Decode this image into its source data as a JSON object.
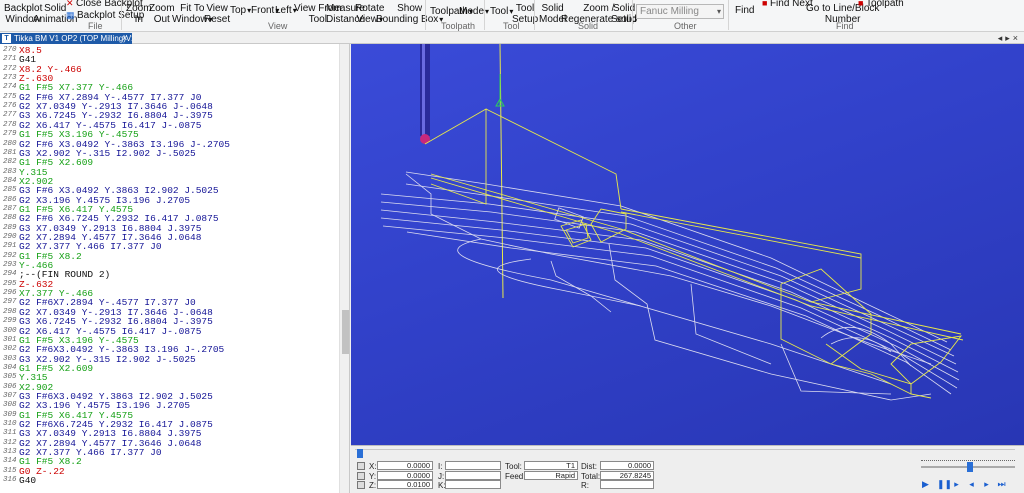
{
  "ribbon": {
    "buttons": [
      {
        "key": "backplot_window",
        "l1": "Backplot",
        "l2": "Window",
        "dd": false
      },
      {
        "key": "solid_animation",
        "l1": "Solid",
        "l2": "Animation",
        "dd": false
      },
      {
        "key": "close_backplot",
        "l1": "Close Backplot",
        "l2": "",
        "dd": false
      },
      {
        "key": "backplot_setup",
        "l1": "Backplot Setup",
        "l2": "",
        "dd": false
      },
      {
        "key": "zoom_in",
        "l1": "Zoom",
        "l2": "In",
        "dd": false
      },
      {
        "key": "zoom_out",
        "l1": "Zoom",
        "l2": "Out",
        "dd": false
      },
      {
        "key": "fit_to_window",
        "l1": "Fit To",
        "l2": "Window",
        "dd": true
      },
      {
        "key": "view_reset",
        "l1": "View",
        "l2": "Reset",
        "dd": false
      },
      {
        "key": "top",
        "l1": "",
        "l2": "Top",
        "dd": true
      },
      {
        "key": "front",
        "l1": "",
        "l2": "Front",
        "dd": true
      },
      {
        "key": "left",
        "l1": "",
        "l2": "Left",
        "dd": true
      },
      {
        "key": "view_from_tool",
        "l1": "View From",
        "l2": "Tool",
        "dd": false
      },
      {
        "key": "measure_distance",
        "l1": "Measure",
        "l2": "Distance",
        "dd": false
      },
      {
        "key": "rotate_view",
        "l1": "Rotate",
        "l2": "View",
        "dd": true
      },
      {
        "key": "show_bounding_box",
        "l1": "Show",
        "l2": "Bounding Box",
        "dd": true
      },
      {
        "key": "toolpath",
        "l1": "Toolpath",
        "l2": "",
        "dd": true
      },
      {
        "key": "mode",
        "l1": "Mode",
        "l2": "",
        "dd": true
      },
      {
        "key": "tool",
        "l1": "Tool",
        "l2": "",
        "dd": true
      },
      {
        "key": "tool_setup",
        "l1": "Tool",
        "l2": "Setup",
        "dd": false
      },
      {
        "key": "solid_model",
        "l1": "Solid",
        "l2": "Model",
        "dd": false
      },
      {
        "key": "zoom_regenerate",
        "l1": "Zoom /",
        "l2": "Regenerate solid",
        "dd": false
      },
      {
        "key": "solid_setup",
        "l1": "Solid",
        "l2": "Setup",
        "dd": false
      },
      {
        "key": "find",
        "l1": "Find",
        "l2": "",
        "dd": false
      },
      {
        "key": "find_next",
        "l1": "Find Next",
        "l2": "",
        "dd": false
      },
      {
        "key": "go_to_line",
        "l1": "Go to Line/Block",
        "l2": "Number",
        "dd": false
      },
      {
        "key": "previous_tool_change",
        "l1": "Previous Tool change",
        "l2": "",
        "dd": false
      },
      {
        "key": "toolpath_statistics",
        "l1": "Toolpath",
        "l2": "Statistics",
        "dd": false
      }
    ],
    "groups": [
      "File",
      "View",
      "Toolpath",
      "Tool",
      "Solid",
      "Other",
      "Find"
    ],
    "machine_select": "Fanuc Milling"
  },
  "tab": {
    "title": "Tikka BM V1 OP2 (TOP Milling)V2.NC",
    "close": "×",
    "controls": "◂▸×"
  },
  "colors": {
    "red": "#cc0000",
    "green": "#14a014",
    "blue": "#141496",
    "black": "#111111",
    "toolpath_white": "#dcdcf0",
    "toolpath_yellow": "#e8e84a",
    "viewport_bg": "#3545cf"
  },
  "code_lines": [
    {
      "n": "270",
      "t": "X8.5",
      "c": "red"
    },
    {
      "n": "271",
      "t": "G41",
      "c": "black"
    },
    {
      "n": "272",
      "t": "X8.2 Y-.466",
      "c": "red"
    },
    {
      "n": "273",
      "t": "Z-.630",
      "c": "red"
    },
    {
      "n": "274",
      "t": "G1 F#5 X7.377 Y-.466",
      "c": "green"
    },
    {
      "n": "275",
      "t": "G2 F#6 X7.2894 Y-.4577 I7.377 J0",
      "c": "blue"
    },
    {
      "n": "276",
      "t": "G2 X7.0349 Y-.2913 I7.3646 J-.0648",
      "c": "blue"
    },
    {
      "n": "277",
      "t": "G3 X6.7245 Y-.2932 I6.8804 J-.3975",
      "c": "blue"
    },
    {
      "n": "278",
      "t": "G2 X6.417 Y-.4575 I6.417 J-.0875",
      "c": "blue"
    },
    {
      "n": "279",
      "t": "G1 F#5 X3.196 Y-.4575",
      "c": "green"
    },
    {
      "n": "280",
      "t": "G2 F#6 X3.0492 Y-.3863 I3.196 J-.2705",
      "c": "blue"
    },
    {
      "n": "281",
      "t": "G3 X2.902 Y-.315 I2.902 J-.5025",
      "c": "blue"
    },
    {
      "n": "282",
      "t": "G1 F#5 X2.609",
      "c": "green"
    },
    {
      "n": "283",
      "t": "Y.315",
      "c": "green"
    },
    {
      "n": "284",
      "t": "X2.902",
      "c": "green"
    },
    {
      "n": "285",
      "t": "G3 F#6 X3.0492 Y.3863 I2.902 J.5025",
      "c": "blue"
    },
    {
      "n": "286",
      "t": "G2 X3.196 Y.4575 I3.196 J.2705",
      "c": "blue"
    },
    {
      "n": "287",
      "t": "G1 F#5 X6.417 Y.4575",
      "c": "green"
    },
    {
      "n": "288",
      "t": "G2 F#6 X6.7245 Y.2932 I6.417 J.0875",
      "c": "blue"
    },
    {
      "n": "289",
      "t": "G3 X7.0349 Y.2913 I6.8804 J.3975",
      "c": "blue"
    },
    {
      "n": "290",
      "t": "G2 X7.2894 Y.4577 I7.3646 J.0648",
      "c": "blue"
    },
    {
      "n": "291",
      "t": "G2 X7.377 Y.466 I7.377 J0",
      "c": "blue"
    },
    {
      "n": "292",
      "t": "G1 F#5 X8.2",
      "c": "green"
    },
    {
      "n": "293",
      "t": "Y-.466",
      "c": "green"
    },
    {
      "n": "294",
      "t": ";--(FIN ROUND 2)",
      "c": "black"
    },
    {
      "n": "295",
      "t": "Z-.632",
      "c": "red"
    },
    {
      "n": "296",
      "t": "X7.377 Y-.466",
      "c": "green"
    },
    {
      "n": "297",
      "t": "G2 F#6X7.2894 Y-.4577 I7.377 J0",
      "c": "blue"
    },
    {
      "n": "298",
      "t": "G2 X7.0349 Y-.2913 I7.3646 J-.0648",
      "c": "blue"
    },
    {
      "n": "299",
      "t": "G3 X6.7245 Y-.2932 I6.8804 J-.3975",
      "c": "blue"
    },
    {
      "n": "300",
      "t": "G2 X6.417 Y-.4575 I6.417 J-.0875",
      "c": "blue"
    },
    {
      "n": "301",
      "t": "G1 F#5 X3.196 Y-.4575",
      "c": "green"
    },
    {
      "n": "302",
      "t": "G2 F#6X3.0492 Y-.3863 I3.196 J-.2705",
      "c": "blue"
    },
    {
      "n": "303",
      "t": "G3 X2.902 Y-.315 I2.902 J-.5025",
      "c": "blue"
    },
    {
      "n": "304",
      "t": "G1 F#5 X2.609",
      "c": "green"
    },
    {
      "n": "305",
      "t": "Y.315",
      "c": "green"
    },
    {
      "n": "306",
      "t": "X2.902",
      "c": "green"
    },
    {
      "n": "307",
      "t": "G3 F#6X3.0492 Y.3863 I2.902 J.5025",
      "c": "blue"
    },
    {
      "n": "308",
      "t": "G2 X3.196 Y.4575 I3.196 J.2705",
      "c": "blue"
    },
    {
      "n": "309",
      "t": "G1 F#5 X6.417 Y.4575",
      "c": "green"
    },
    {
      "n": "310",
      "t": "G2 F#6X6.7245 Y.2932 I6.417 J.0875",
      "c": "blue"
    },
    {
      "n": "311",
      "t": "G3 X7.0349 Y.2913 I6.8804 J.3975",
      "c": "blue"
    },
    {
      "n": "312",
      "t": "G2 X7.2894 Y.4577 I7.3646 J.0648",
      "c": "blue"
    },
    {
      "n": "313",
      "t": "G2 X7.377 Y.466 I7.377 J0",
      "c": "blue"
    },
    {
      "n": "314",
      "t": "G1 F#5 X8.2",
      "c": "green"
    },
    {
      "n": "315",
      "t": "G0 Z-.22",
      "c": "red"
    },
    {
      "n": "316",
      "t": "G40",
      "c": "black"
    }
  ],
  "bottom_panel": {
    "x_label": "X:",
    "x_value": "0.0000",
    "y_label": "Y:",
    "y_value": "0.0000",
    "z_label": "Z:",
    "z_value": "0.0100",
    "i_label": "I:",
    "i_value": "",
    "j_label": "J:",
    "j_value": "",
    "k_label": "K:",
    "k_value": "",
    "tool_label": "Tool:",
    "tool_value": "T1",
    "feed_label": "Feed:",
    "feed_value": "Rapid",
    "dist_label": "Dist:",
    "dist_value": "0.0000",
    "total_label": "Total:",
    "total_value": "267.8245",
    "r_label": "R:",
    "r_value": ""
  }
}
